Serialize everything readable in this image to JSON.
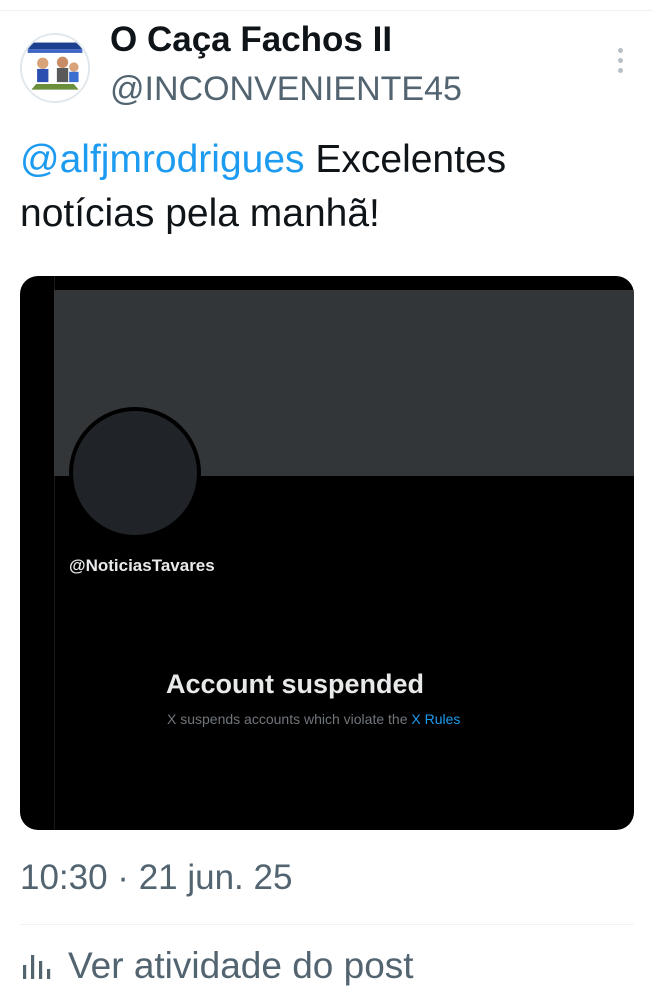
{
  "tweet": {
    "author": {
      "display_name": "O Caça Fachos II",
      "handle": "@INCONVENIENTE45",
      "avatar_icon": "cartoon-avatar"
    },
    "text": {
      "mention": "@alfjmrodrigues",
      "body": " Excelentes notícias pela manhã!"
    },
    "timestamp": "10:30 · 21 jun. 25",
    "activity_label": "Ver atividade do post",
    "more_icon": "more-vertical-icon",
    "activity_icon": "analytics-icon"
  },
  "embedded_image": {
    "handle": "@NoticiasTavares",
    "title": "Account suspended",
    "description_prefix": "X suspends accounts which violate the ",
    "rules_link": "X Rules"
  },
  "colors": {
    "link": "#1d9bf0",
    "secondary_text": "#536471",
    "primary_text": "#0f1419",
    "banner": "#333639",
    "media_background": "#000000"
  }
}
